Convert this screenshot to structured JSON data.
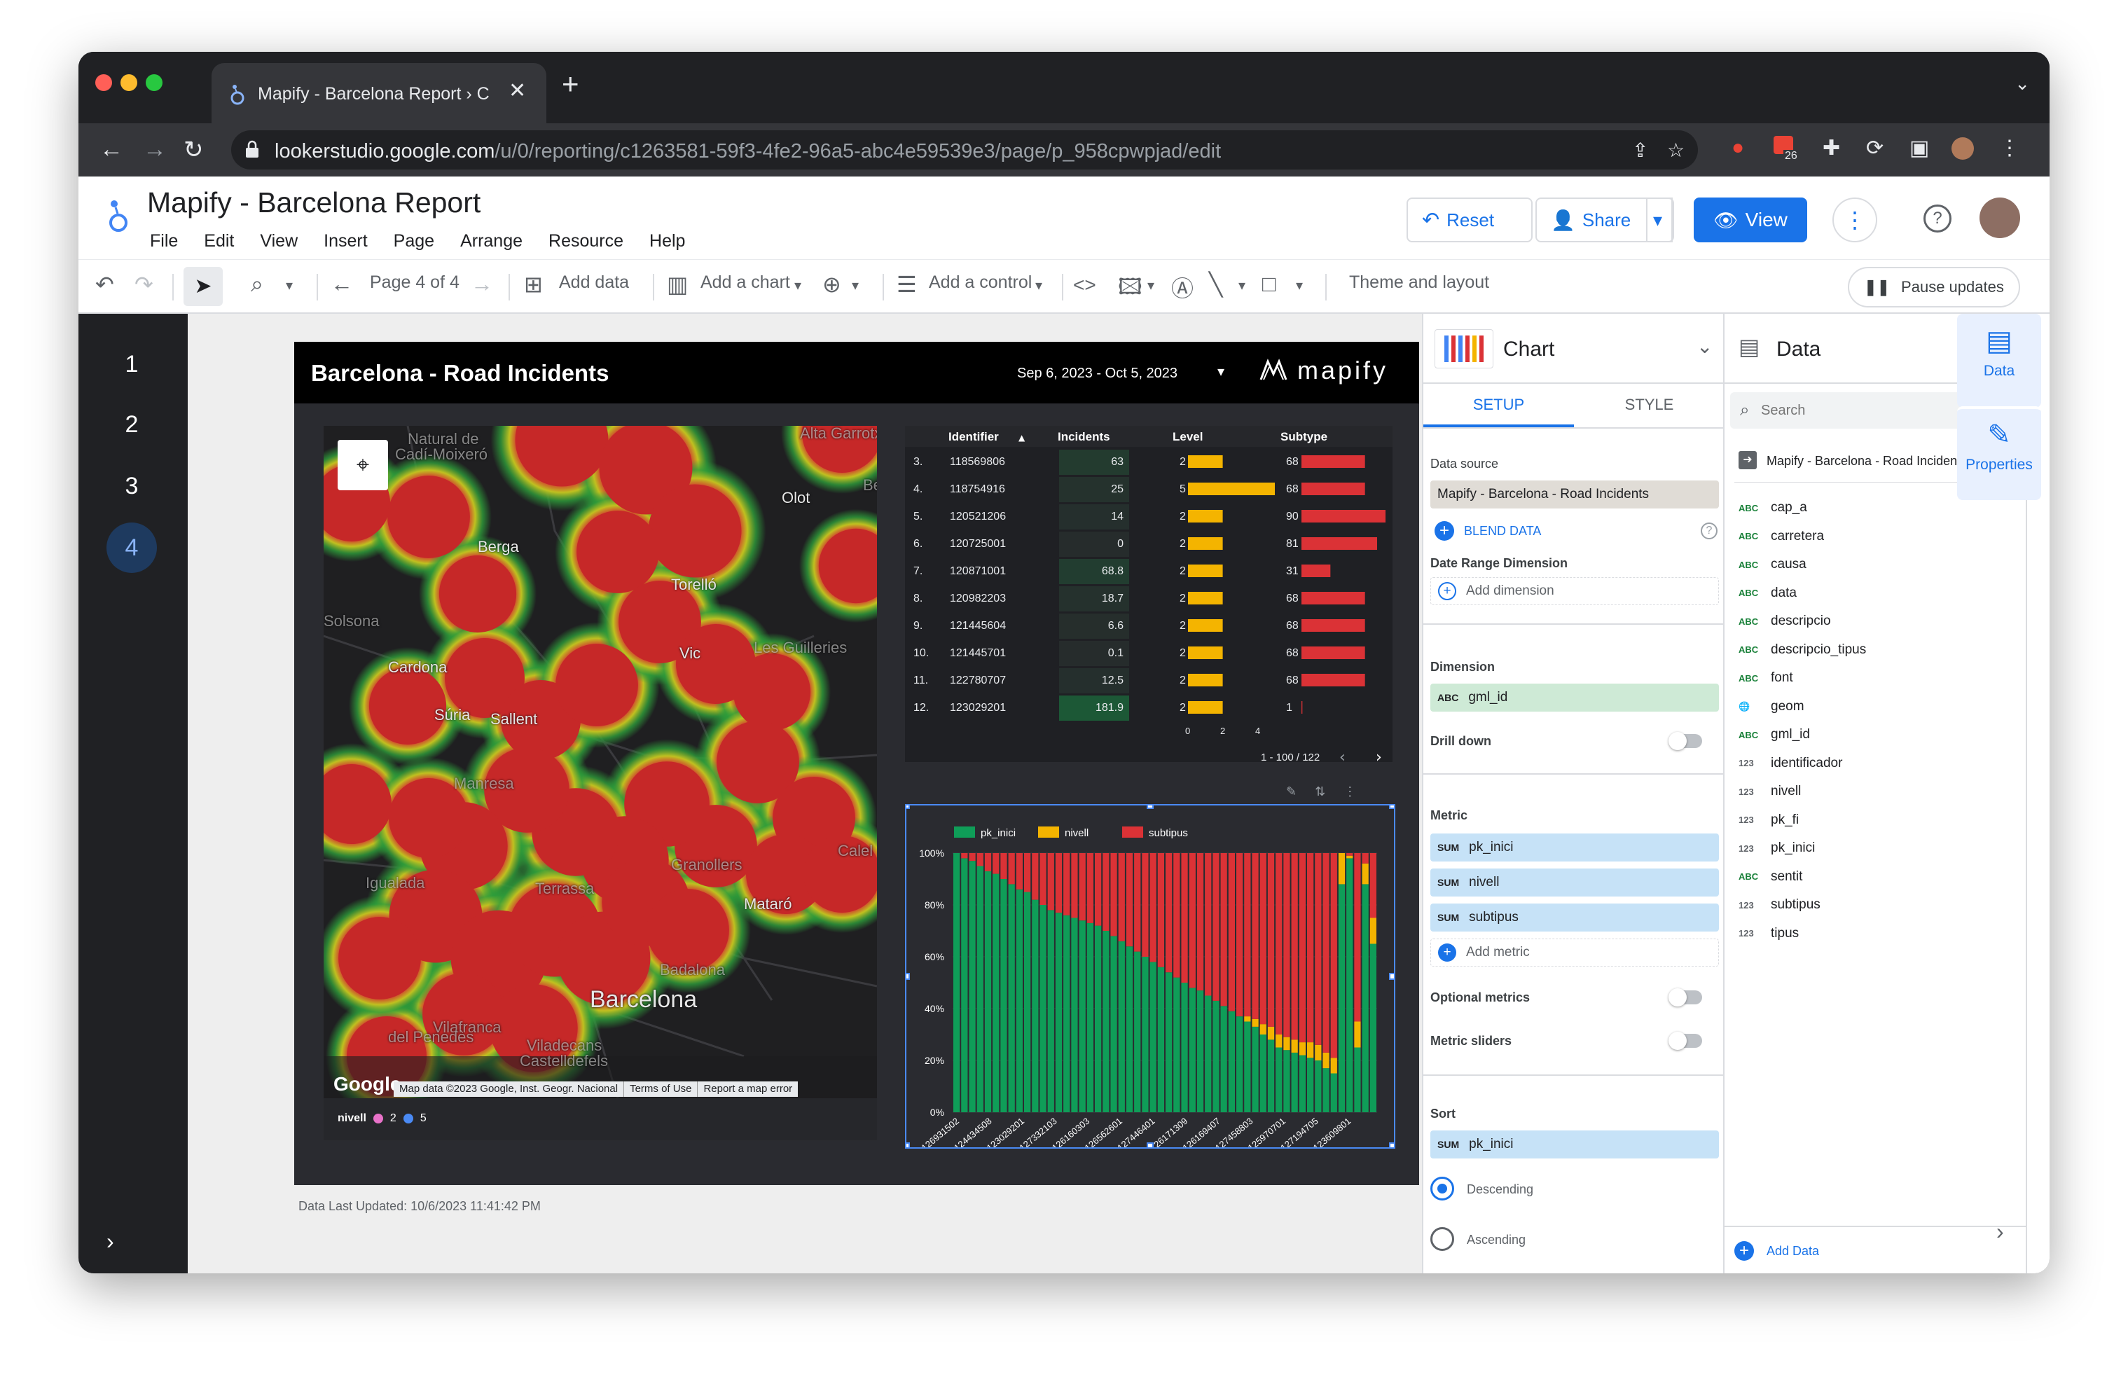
{
  "browser": {
    "tab_title": "Mapify - Barcelona Report › C",
    "url_host": "lookerstudio.google.com",
    "url_path": "/u/0/reporting/c1263581-59f3-4fe2-96a5-abc4e59539e3/page/p_958cpwpjad/edit",
    "badge_count": "26"
  },
  "app": {
    "title": "Mapify - Barcelona Report",
    "menus": [
      "File",
      "Edit",
      "View",
      "Insert",
      "Page",
      "Arrange",
      "Resource",
      "Help"
    ],
    "reset_label": "Reset",
    "share_label": "Share",
    "view_label": "View"
  },
  "toolbar": {
    "page_indicator": "Page 4 of 4",
    "add_data": "Add data",
    "add_chart": "Add a chart",
    "add_control": "Add a control",
    "theme_layout": "Theme and layout",
    "pause_updates": "Pause updates"
  },
  "pages": [
    "1",
    "2",
    "3",
    "4"
  ],
  "report": {
    "title": "Barcelona - Road Incidents",
    "date_range": "Sep 6, 2023 - Oct 5, 2023",
    "logo_text": "mapify",
    "last_updated": "Data Last Updated: 10/6/2023 11:41:42 PM",
    "map": {
      "labels": [
        {
          "text": "Natural de",
          "cls": "dim"
        },
        {
          "text": "Cadí-Moixeró",
          "cls": "dim"
        },
        {
          "text": "Olot",
          "cls": ""
        },
        {
          "text": "Berga",
          "cls": ""
        },
        {
          "text": "Torelló",
          "cls": ""
        },
        {
          "text": "Solsona",
          "cls": "dim"
        },
        {
          "text": "Vic",
          "cls": ""
        },
        {
          "text": "Les Guilleries",
          "cls": "dim"
        },
        {
          "text": "Cardona",
          "cls": ""
        },
        {
          "text": "Súria",
          "cls": ""
        },
        {
          "text": "Sallent",
          "cls": ""
        },
        {
          "text": "Manresa",
          "cls": "dim"
        },
        {
          "text": "Granollers",
          "cls": "dim"
        },
        {
          "text": "Igualada",
          "cls": "dim"
        },
        {
          "text": "Terrassa",
          "cls": "dim"
        },
        {
          "text": "Mataró",
          "cls": ""
        },
        {
          "text": "Badalona",
          "cls": "dim"
        },
        {
          "text": "Barcelona",
          "cls": "big"
        },
        {
          "text": "Vilafranca",
          "cls": "dim"
        },
        {
          "text": "del Penedès",
          "cls": "dim"
        },
        {
          "text": "Viladecans",
          "cls": "dim"
        },
        {
          "text": "Castelldefels",
          "cls": "dim"
        },
        {
          "text": "Calel",
          "cls": "dim"
        },
        {
          "text": "Be",
          "cls": "dim"
        },
        {
          "text": "Alta Garrotxa",
          "cls": "dim"
        }
      ],
      "attribution": [
        "Map data ©2023 Google, Inst. Geogr. Nacional",
        "Terms of Use",
        "Report a map error"
      ],
      "google_text": "Google",
      "legend_title": "nivell",
      "legend_items": [
        {
          "label": "2",
          "color": "#e872c9"
        },
        {
          "label": "5",
          "color": "#4a8af4"
        }
      ]
    },
    "table": {
      "headers": [
        "Identifier",
        "Incidents",
        "Level",
        "Subtype"
      ],
      "level_max": 5,
      "subtype_max": 90,
      "level_axis": [
        "0",
        "2",
        "4"
      ],
      "rows": [
        {
          "rank": "3.",
          "id": "118569806",
          "incidents": 63,
          "incidents_text": "63",
          "level": 2,
          "subtype": 68
        },
        {
          "rank": "4.",
          "id": "118754916",
          "incidents": 25,
          "incidents_text": "25",
          "level": 5,
          "subtype": 68
        },
        {
          "rank": "5.",
          "id": "120521206",
          "incidents": 14,
          "incidents_text": "14",
          "level": 2,
          "subtype": 90
        },
        {
          "rank": "6.",
          "id": "120725001",
          "incidents": 0,
          "incidents_text": "0",
          "level": 2,
          "subtype": 81
        },
        {
          "rank": "7.",
          "id": "120871001",
          "incidents": 68.8,
          "incidents_text": "68.8",
          "level": 2,
          "subtype": 31
        },
        {
          "rank": "8.",
          "id": "120982203",
          "incidents": 18.7,
          "incidents_text": "18.7",
          "level": 2,
          "subtype": 68
        },
        {
          "rank": "9.",
          "id": "121445604",
          "incidents": 6.6,
          "incidents_text": "6.6",
          "level": 2,
          "subtype": 68
        },
        {
          "rank": "10.",
          "id": "121445701",
          "incidents": 0.1,
          "incidents_text": "0.1",
          "level": 2,
          "subtype": 68
        },
        {
          "rank": "11.",
          "id": "122780707",
          "incidents": 12.5,
          "incidents_text": "12.5",
          "level": 2,
          "subtype": 68
        },
        {
          "rank": "12.",
          "id": "123029201",
          "incidents": 181.9,
          "incidents_text": "181.9",
          "level": 2,
          "subtype": 1
        }
      ],
      "pagination": "1 - 100 / 122"
    }
  },
  "chart_data": {
    "type": "bar",
    "stacked": "percent",
    "title": "",
    "legend_position": "top-left",
    "series": [
      {
        "name": "pk_inici",
        "color": "#0f9d58"
      },
      {
        "name": "nivell",
        "color": "#f4b400"
      },
      {
        "name": "subtipus",
        "color": "#db3236"
      }
    ],
    "yticks": [
      "100%",
      "80%",
      "60%",
      "40%",
      "20%",
      "0%"
    ],
    "ylim": [
      0,
      100
    ],
    "xticks": [
      "126931502",
      "124434508",
      "123029201",
      "127332103",
      "126160303",
      "126562601",
      "127446401",
      "126171309",
      "126169407",
      "127458803",
      "125970701",
      "127194705",
      "123609801"
    ],
    "green_pct": [
      100,
      98,
      97,
      95,
      93,
      92,
      90,
      88,
      86,
      85,
      82,
      80,
      78,
      77,
      76,
      75,
      74,
      73,
      72,
      70,
      68,
      66,
      64,
      62,
      60,
      58,
      56,
      54,
      52,
      50,
      48,
      47,
      45,
      43,
      41,
      39,
      37,
      35,
      33,
      30,
      28,
      25,
      24,
      23,
      22,
      21,
      20,
      17,
      15,
      88,
      98,
      25,
      88,
      65
    ],
    "yellow_pct": [
      0,
      0,
      0,
      0,
      0,
      0,
      0,
      0,
      0,
      0,
      0,
      0,
      0,
      0,
      0,
      0,
      0,
      0,
      0,
      0,
      0,
      0,
      0,
      0,
      0,
      0,
      0,
      0,
      0,
      0,
      0,
      0,
      0,
      0,
      0,
      0,
      0,
      2,
      3,
      4,
      5,
      5,
      5,
      5,
      5,
      6,
      6,
      6,
      6,
      12,
      1,
      10,
      8,
      10
    ]
  },
  "properties_panel": {
    "title": "Chart",
    "tabs": [
      "SETUP",
      "STYLE"
    ],
    "data_source_label": "Data source",
    "data_source_value": "Mapify - Barcelona - Road Incidents",
    "blend_data": "BLEND DATA",
    "date_range_dimension": "Date Range Dimension",
    "add_dimension": "Add dimension",
    "dimension_label": "Dimension",
    "dimension_value": "gml_id",
    "drill_down": "Drill down",
    "metric_label": "Metric",
    "metrics": [
      "pk_inici",
      "nivell",
      "subtipus"
    ],
    "sum_tag": "SUM",
    "abc_tag": "ABC",
    "add_metric": "Add metric",
    "optional_metrics": "Optional metrics",
    "metric_sliders": "Metric sliders",
    "sort_label": "Sort",
    "sort_value": "pk_inici",
    "descending": "Descending",
    "ascending": "Ascending"
  },
  "data_panel": {
    "title": "Data",
    "search_placeholder": "Search",
    "source": "Mapify - Barcelona - Road Incidents",
    "fields": [
      {
        "type": "ABC",
        "name": "cap_a"
      },
      {
        "type": "ABC",
        "name": "carretera"
      },
      {
        "type": "ABC",
        "name": "causa"
      },
      {
        "type": "ABC",
        "name": "data"
      },
      {
        "type": "ABC",
        "name": "descripcio"
      },
      {
        "type": "ABC",
        "name": "descripcio_tipus"
      },
      {
        "type": "ABC",
        "name": "font"
      },
      {
        "type": "GEO",
        "name": "geom"
      },
      {
        "type": "ABC",
        "name": "gml_id"
      },
      {
        "type": "123",
        "name": "identificador"
      },
      {
        "type": "123",
        "name": "nivell"
      },
      {
        "type": "123",
        "name": "pk_fi"
      },
      {
        "type": "123",
        "name": "pk_inici"
      },
      {
        "type": "ABC",
        "name": "sentit"
      },
      {
        "type": "123",
        "name": "subtipus"
      },
      {
        "type": "123",
        "name": "tipus"
      }
    ],
    "add_data": "Add Data"
  },
  "side_rail": {
    "data_label": "Data",
    "properties_label": "Properties"
  },
  "colors": {
    "accent": "#1a73e8",
    "heat_red": "#d32f2f",
    "heat_green": "#2e9d3a",
    "level_bar": "#f4b400",
    "subtype_bar": "#db3236"
  }
}
